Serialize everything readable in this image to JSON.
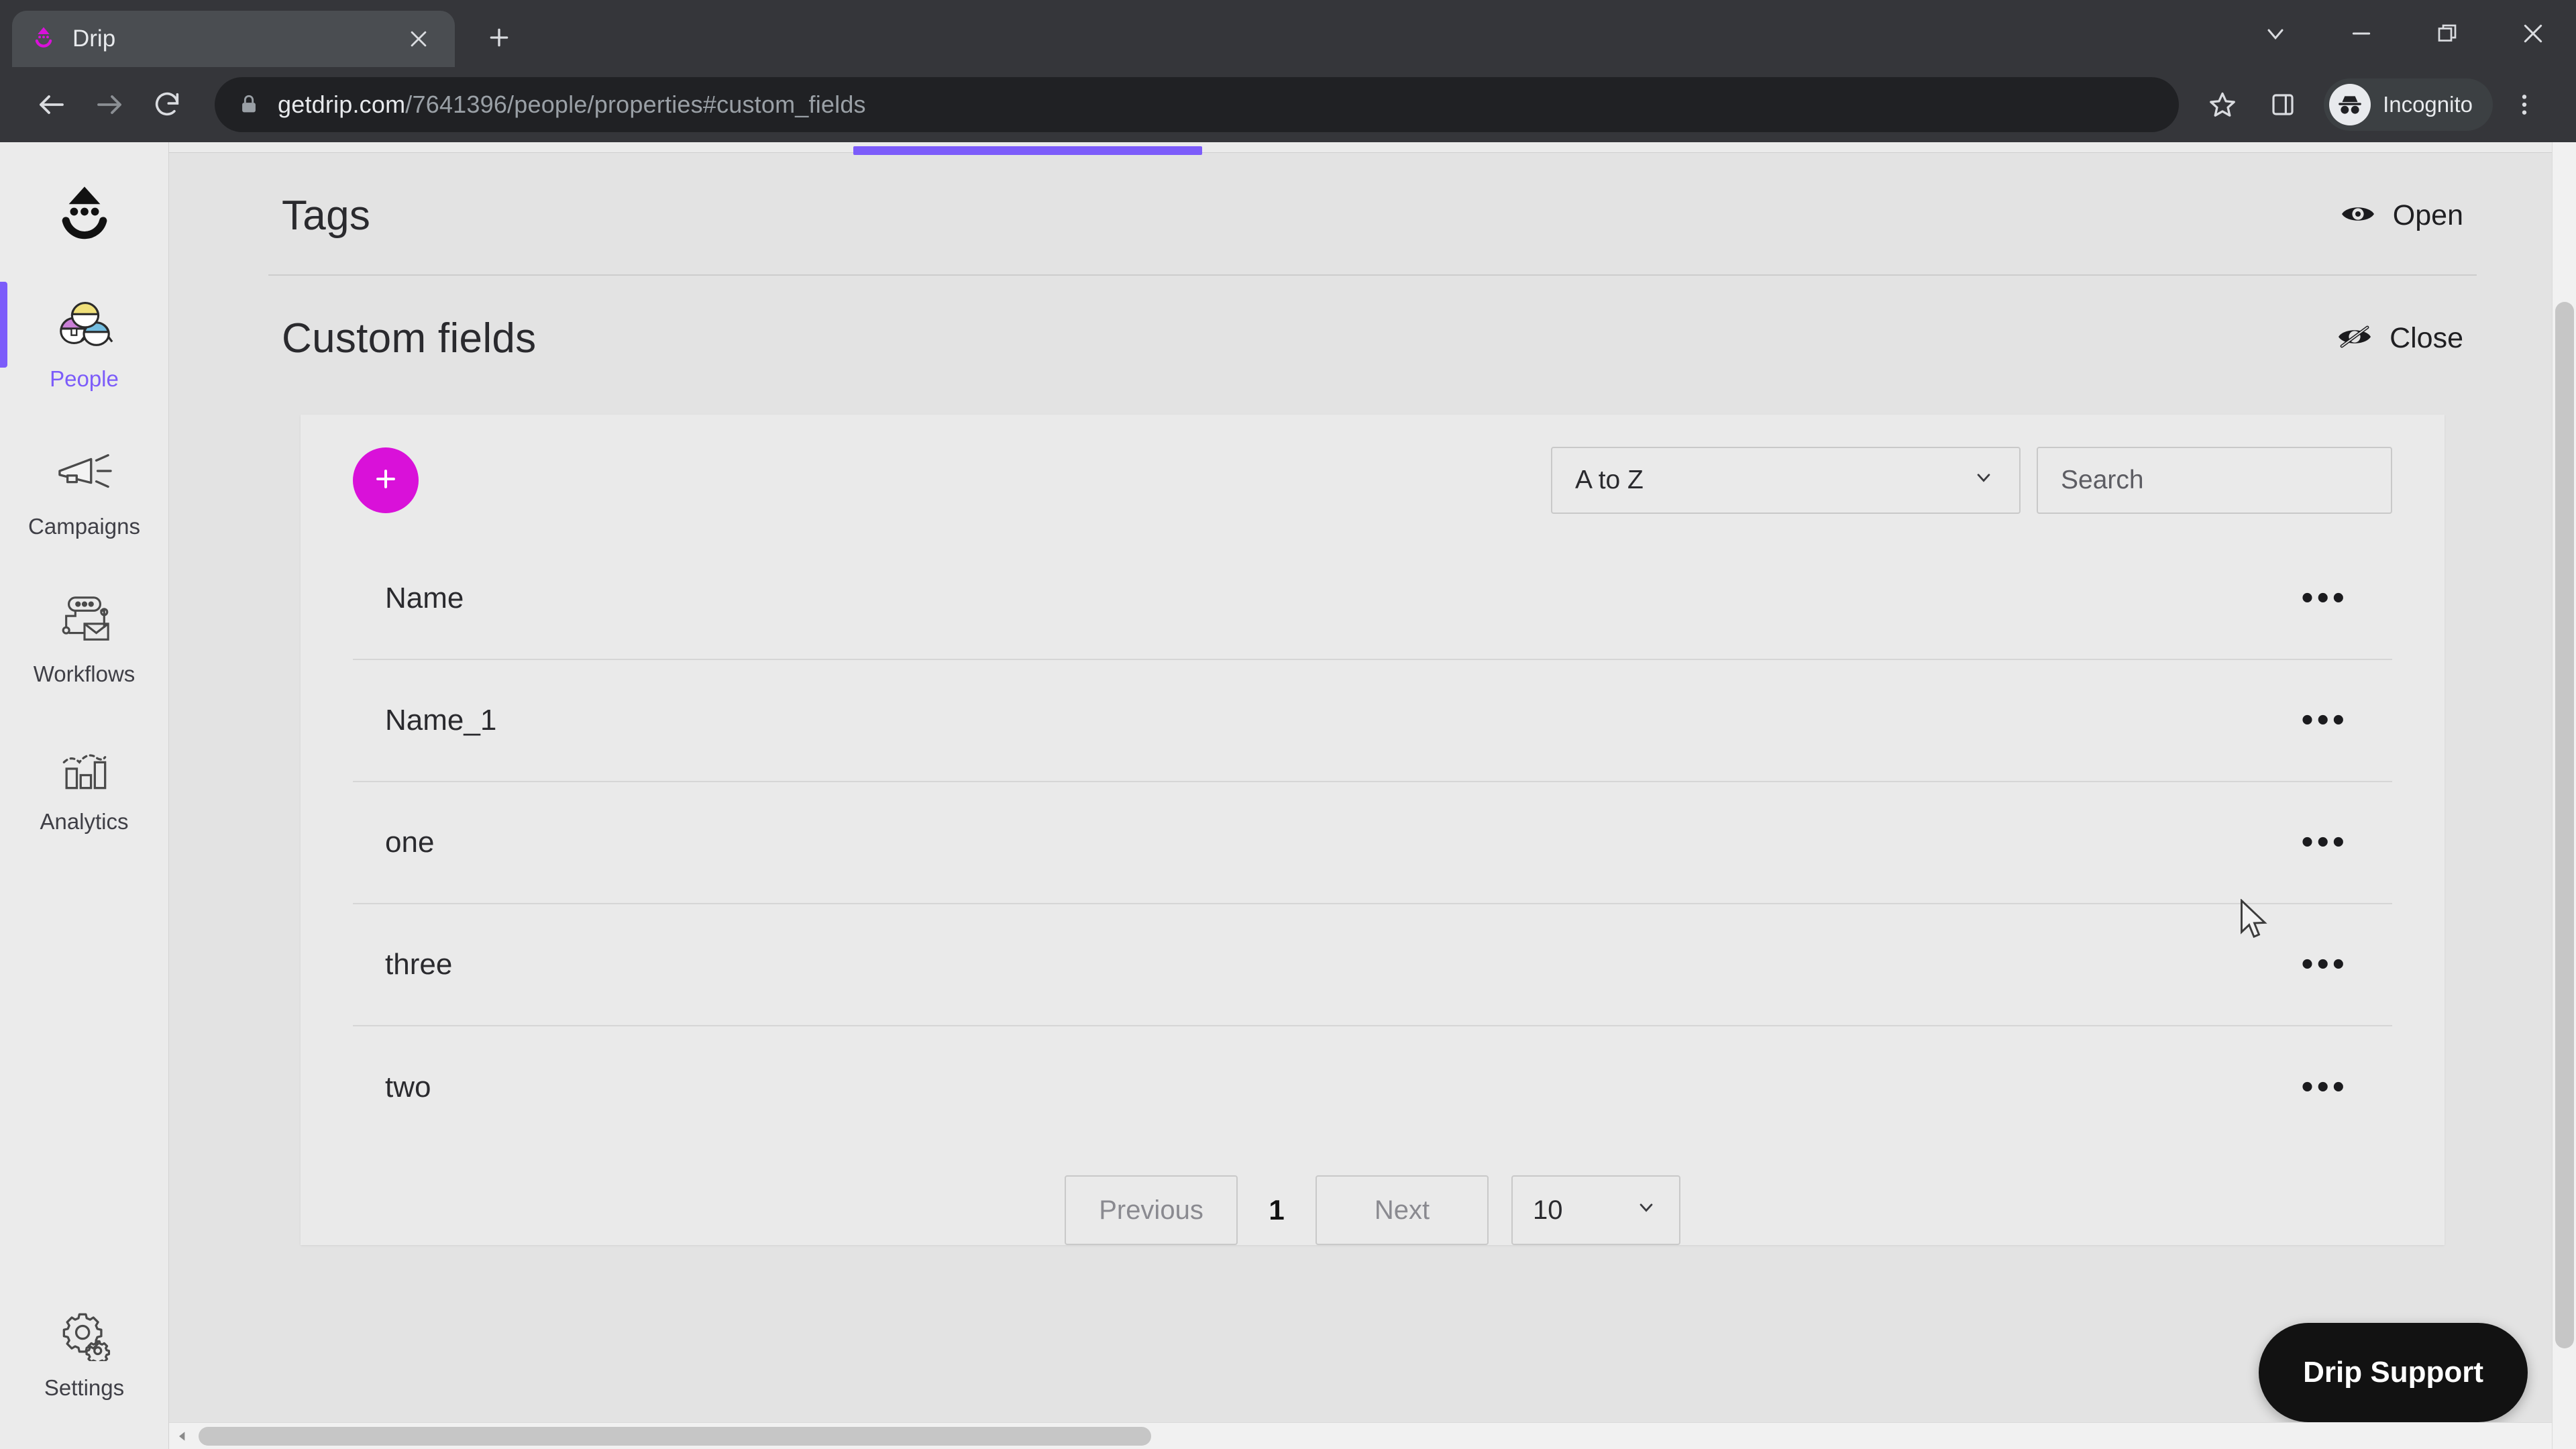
{
  "browser": {
    "tab": {
      "title": "Drip",
      "favicon_icon": "drip-logo-icon",
      "close_icon": "close-icon"
    },
    "new_tab_icon": "plus-icon",
    "window_controls": [
      {
        "name": "tab-search",
        "icon": "chevron-down-icon"
      },
      {
        "name": "minimize",
        "icon": "minimize-icon"
      },
      {
        "name": "maximize",
        "icon": "restore-icon"
      },
      {
        "name": "close",
        "icon": "close-icon"
      }
    ],
    "nav": {
      "back_icon": "arrow-left-icon",
      "forward_icon": "arrow-right-icon",
      "reload_icon": "reload-icon"
    },
    "omnibox": {
      "lock_icon": "lock-icon",
      "url_host": "getdrip.com",
      "url_path": "/7641396/people/properties#custom_fields",
      "url_full": "getdrip.com/7641396/people/properties#custom_fields"
    },
    "toolbar_right": {
      "bookmark_icon": "star-icon",
      "side_panel_icon": "side-panel-icon",
      "profile_label": "Incognito",
      "profile_icon": "incognito-icon",
      "menu_icon": "three-dots-vertical-icon"
    }
  },
  "sidebar": {
    "logo_icon": "drip-logo-icon",
    "items": [
      {
        "label": "People",
        "icon": "people-icon",
        "active": true
      },
      {
        "label": "Campaigns",
        "icon": "megaphone-icon",
        "active": false
      },
      {
        "label": "Workflows",
        "icon": "workflow-icon",
        "active": false
      },
      {
        "label": "Analytics",
        "icon": "bar-chart-icon",
        "active": false
      }
    ],
    "bottom_item": {
      "label": "Settings",
      "icon": "gears-icon"
    }
  },
  "page": {
    "sections": [
      {
        "title": "Tags",
        "toggle_label": "Open",
        "toggle_icon": "eye-icon"
      },
      {
        "title": "Custom fields",
        "toggle_label": "Close",
        "toggle_icon": "eye-off-icon"
      }
    ]
  },
  "custom_fields_panel": {
    "add_button": {
      "label": "+",
      "icon": "plus-icon",
      "color": "#d911d9"
    },
    "sort": {
      "value": "A to Z",
      "chevron_icon": "chevron-down-icon"
    },
    "search": {
      "value": "",
      "placeholder": "Search",
      "icon": "search-icon"
    },
    "rows": [
      {
        "name": "Name",
        "menu_icon": "kebab-horizontal-icon",
        "menu_label": "•••"
      },
      {
        "name": "Name_1",
        "menu_icon": "kebab-horizontal-icon",
        "menu_label": "•••"
      },
      {
        "name": "one",
        "menu_icon": "kebab-horizontal-icon",
        "menu_label": "•••"
      },
      {
        "name": "three",
        "menu_icon": "kebab-horizontal-icon",
        "menu_label": "•••"
      },
      {
        "name": "two",
        "menu_icon": "kebab-horizontal-icon",
        "menu_label": "•••"
      }
    ],
    "pagination": {
      "previous_label": "Previous",
      "current_page": "1",
      "next_label": "Next",
      "page_size": "10",
      "page_size_chevron_icon": "chevron-down-icon"
    }
  },
  "support": {
    "label": "Drip Support"
  },
  "theme": {
    "accent_purple": "#7c5cfa",
    "accent_magenta": "#d911d9",
    "page_bg": "#e3e3e3",
    "chrome_bg": "#35363a",
    "omnibox_bg": "#202124"
  }
}
